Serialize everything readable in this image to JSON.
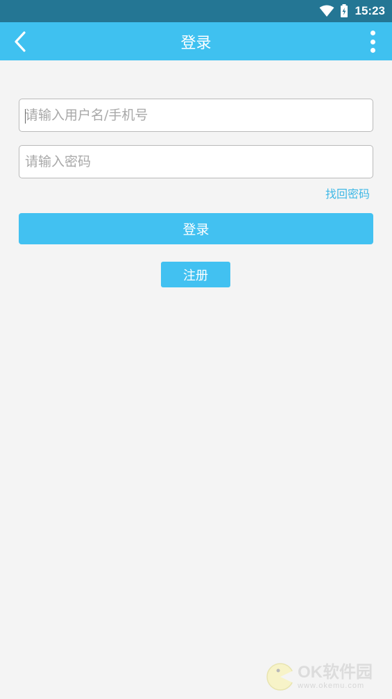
{
  "status_bar": {
    "time": "15:23",
    "icons": [
      "wifi-icon",
      "battery-charging-icon"
    ]
  },
  "app_bar": {
    "title": "登录",
    "back_icon": "chevron-left-icon",
    "menu_icon": "more-vertical-icon"
  },
  "login_form": {
    "username_placeholder": "请输入用户名/手机号",
    "username_value": "",
    "password_placeholder": "请输入密码",
    "password_value": "",
    "forgot_password_label": "找回密码",
    "login_button_label": "登录",
    "register_button_label": "注册"
  },
  "watermark": {
    "main": "OK软件园",
    "url": "www.okemu.com"
  },
  "colors": {
    "status_bar": "#247694",
    "primary": "#3fc1f0",
    "background": "#f4f4f4",
    "link": "#3fb8e6"
  }
}
